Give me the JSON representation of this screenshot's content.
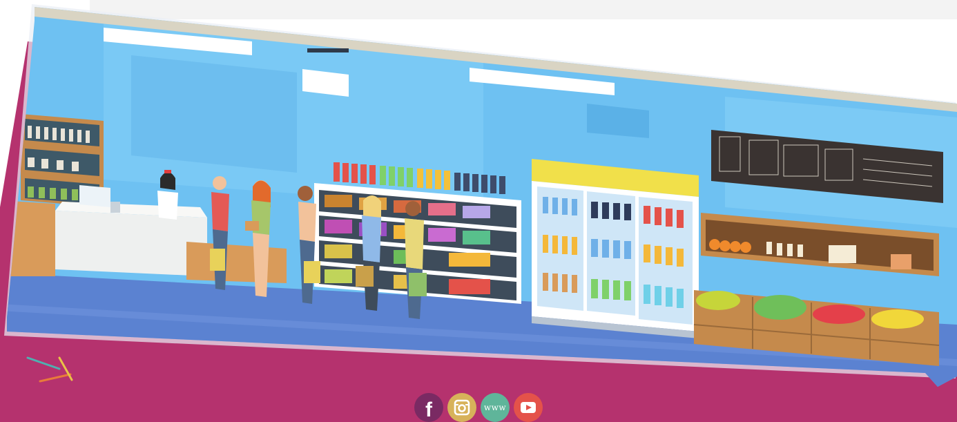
{
  "page": {
    "background_color": "#ffffff",
    "panel_color": "#b5326e",
    "strip_color": "#f3f3f3"
  },
  "banner": {
    "illustration": "supermarket-checkout-scene",
    "wall_color": "#6ec1f2",
    "floor_color": "#5b82d1"
  },
  "social": [
    {
      "name": "facebook",
      "glyph": "f",
      "color": "#7a2a63",
      "icon": "facebook-icon"
    },
    {
      "name": "instagram",
      "color": "#d7b25a",
      "icon": "instagram-icon"
    },
    {
      "name": "website",
      "glyph": "www",
      "color": "#5fb59a",
      "icon": "globe-www-icon"
    },
    {
      "name": "youtube",
      "color": "#e4524a",
      "icon": "youtube-icon"
    }
  ]
}
